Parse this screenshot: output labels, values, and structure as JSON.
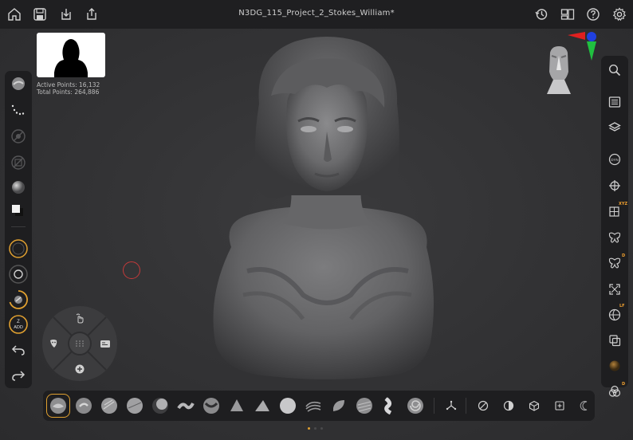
{
  "app": {
    "document_title": "N3DG_115_Project_2_Stokes_William*"
  },
  "topbar": {
    "left_icons": [
      "home-icon",
      "save-icon",
      "import-icon",
      "share-icon"
    ],
    "right_icons": [
      "history-icon",
      "layout-icon",
      "help-icon",
      "settings-icon"
    ]
  },
  "stats": {
    "active_points": "Active Points: 16,132",
    "total_points": "Total Points: 264,886"
  },
  "left_toolbar": {
    "items": [
      "brush-sphere-icon",
      "stroke-dots-icon",
      "alpha-disabled-icon",
      "texture-disabled-icon",
      "material-sphere-icon",
      "color-swatch-icon",
      "draw-size-icon",
      "focal-shift-icon",
      "intensity-icon",
      "zadd-icon",
      "undo-icon",
      "redo-icon"
    ],
    "zadd_label": "Z\nADD",
    "zadd_short": "ADD",
    "zadd_top": "Z"
  },
  "right_toolbar": {
    "items": [
      "search-icon",
      "subtools-icon",
      "layers-icon",
      "dynamesh-icon",
      "move-gizmo-icon",
      "xyz-symmetry-icon",
      "symmetry-icon",
      "symmetry-d-icon",
      "frame-icon",
      "perspective-icon",
      "duplicate-icon",
      "material-icon",
      "transparency-icon"
    ],
    "tags": {
      "xyz": "XYZ",
      "d": "D",
      "lf": "LF",
      "d2": "D"
    }
  },
  "radial_menu": {
    "items": [
      "gesture-icon",
      "mask-icon",
      "grid-icon",
      "panel-icon",
      "add-icon"
    ]
  },
  "bottom_bar": {
    "brushes": [
      "clay-buildup",
      "standard",
      "move",
      "dam-standard",
      "inflate",
      "snakehook",
      "trim-dynamic",
      "pinch",
      "hpolish",
      "smooth",
      "clay-tubes",
      "flatten",
      "planar",
      "curve-tube",
      "orb-cracks"
    ],
    "tools": [
      "transpose-icon",
      "smooth-toggle-icon",
      "mask-toggle-icon",
      "cube-icon",
      "select-icon",
      "moon-icon"
    ]
  },
  "colors": {
    "accent": "#e0a030",
    "cursor": "#c43a3a",
    "gizmo_x": "#e02020",
    "gizmo_y": "#20c040",
    "gizmo_z": "#2040e0"
  }
}
